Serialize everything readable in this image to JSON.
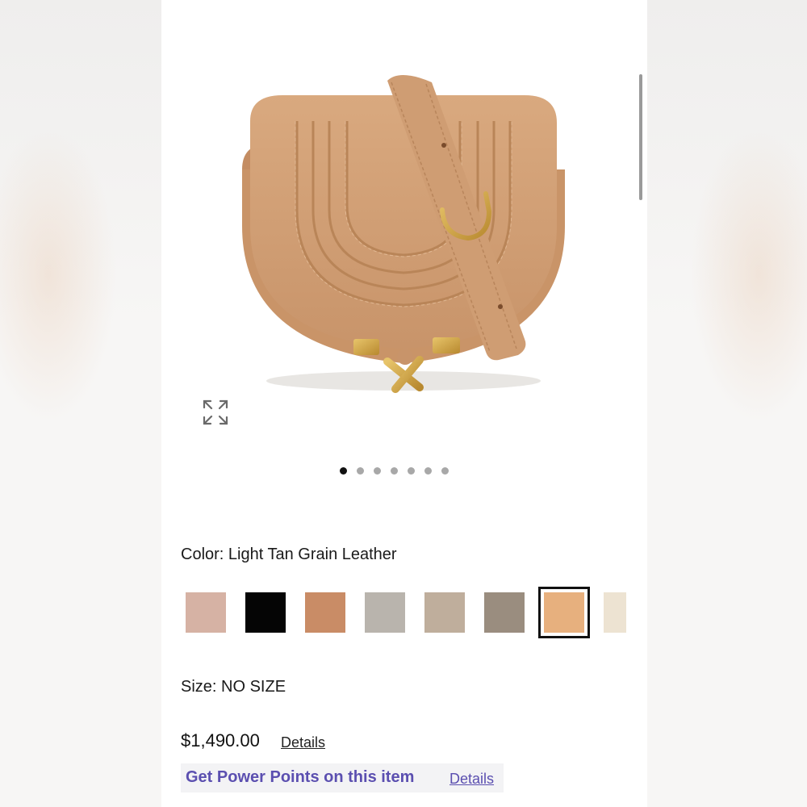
{
  "gallery": {
    "image_alt": "Light tan leather saddle crossbody bag",
    "expand_icon": "expand-arrows-icon",
    "dot_count": 7,
    "active_dot": 0
  },
  "color": {
    "label": "Color:",
    "value": "Light Tan Grain Leather",
    "swatches": [
      {
        "name": "blush",
        "hex": "#d6b2a4"
      },
      {
        "name": "black",
        "hex": "#050505"
      },
      {
        "name": "caramel",
        "hex": "#c98c66"
      },
      {
        "name": "light-grey",
        "hex": "#b9b4ad"
      },
      {
        "name": "taupe",
        "hex": "#bfae9c"
      },
      {
        "name": "grey-brown",
        "hex": "#9a8d7f"
      },
      {
        "name": "light-tan",
        "hex": "#e7b07e",
        "selected": true
      },
      {
        "name": "cream",
        "hex": "#ede3d2"
      }
    ]
  },
  "size": {
    "label": "Size:",
    "value": "NO SIZE"
  },
  "price": {
    "amount": "$1,490.00",
    "details_label": "Details"
  },
  "power_points": {
    "text": "Get Power Points on this item",
    "details_label": "Details",
    "accent": "#5b4fb0"
  }
}
